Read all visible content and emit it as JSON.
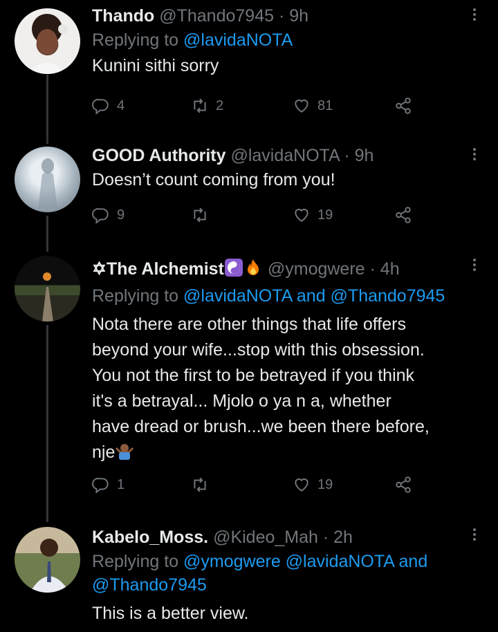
{
  "tweets": [
    {
      "name": "Thando",
      "handle": "@Thando7945",
      "time": "· 9h",
      "replying_prefix": "Replying to",
      "replying_to": "@lavidaNOTA",
      "text": "Kunini sithi sorry",
      "replies": "4",
      "retweets": "2",
      "likes": "81"
    },
    {
      "name": "GOOD Authority",
      "handle": "@lavidaNOTA",
      "time": "· 9h",
      "text": "Doesn’t count coming from you!",
      "replies": "9",
      "retweets": "",
      "likes": "19"
    },
    {
      "name": "✡The Alchemist",
      "handle": "@ymogwere",
      "time": "· 4h",
      "replying_prefix": "Replying to",
      "replying_to": "@lavidaNOTA and @Thando7945",
      "text_lines": [
        "Nota there are other things that life offers",
        "beyond your wife...stop with this obsession.",
        "You not the first to be betrayed if you think",
        "it's a betrayal... Mjolo o ya n   a, whether",
        "have dread or brush...we been there before,",
        "nje"
      ],
      "replies": "1",
      "retweets": "",
      "likes": "19"
    },
    {
      "name": "Kabelo_Moss.",
      "handle": "@Kideo_Mah",
      "time": "· 2h",
      "replying_prefix": "Replying to",
      "replying_to_line1": "@ymogwere @lavidaNOTA and",
      "replying_to_line2": "@Thando7945",
      "text": "This is a better view."
    }
  ],
  "icons": [
    "reply-icon",
    "retweet-icon",
    "like-icon",
    "share-icon",
    "more-icon",
    "yin-yang-icon",
    "fire-icon",
    "shrug-emoji-icon"
  ],
  "colors": {
    "background": "#000000",
    "link": "#1d9bf0",
    "muted": "#71767b",
    "text": "#e7e9ea"
  }
}
